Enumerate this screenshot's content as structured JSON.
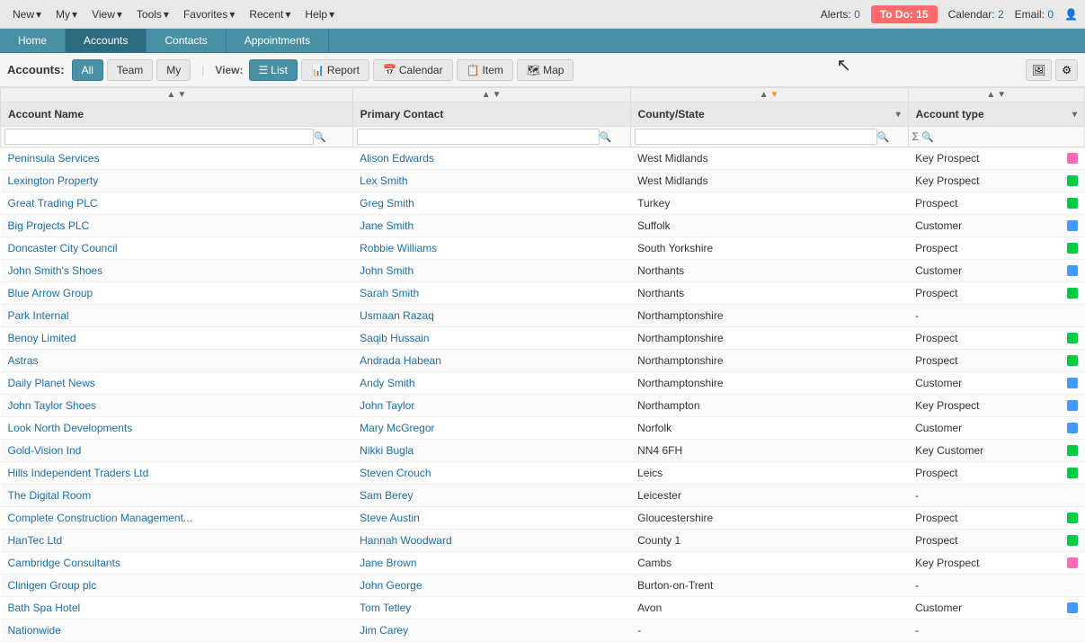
{
  "topnav": {
    "new_label": "New",
    "my_label": "My",
    "view_label": "View",
    "tools_label": "Tools",
    "favorites_label": "Favorites",
    "recent_label": "Recent",
    "help_label": "Help",
    "alerts_label": "Alerts:",
    "alerts_count": "0",
    "todo_label": "To Do:",
    "todo_count": "15",
    "calendar_label": "Calendar:",
    "calendar_count": "2",
    "email_label": "Email:",
    "email_count": "0"
  },
  "pagetabs": [
    {
      "label": "Home",
      "active": false
    },
    {
      "label": "Accounts",
      "active": true
    },
    {
      "label": "Contacts",
      "active": false
    },
    {
      "label": "Appointments",
      "active": false
    }
  ],
  "toolbar": {
    "accounts_label": "Accounts:",
    "all_label": "All",
    "team_label": "Team",
    "my_label": "My",
    "view_label": "View:",
    "list_label": "List",
    "report_label": "Report",
    "calendar_label": "Calendar",
    "item_label": "Item",
    "map_label": "Map"
  },
  "table": {
    "columns": [
      {
        "id": "account_name",
        "label": "Account Name",
        "has_dropdown": false
      },
      {
        "id": "primary_contact",
        "label": "Primary Contact",
        "has_dropdown": false
      },
      {
        "id": "county_state",
        "label": "County/State",
        "has_dropdown": true
      },
      {
        "id": "account_type",
        "label": "Account type",
        "has_dropdown": true
      }
    ],
    "rows": [
      {
        "account": "Peninsula Services",
        "contact": "Alison Edwards",
        "county": "West Midlands",
        "type": "Key Prospect",
        "color": "#ff69b4"
      },
      {
        "account": "Lexington Property",
        "contact": "Lex Smith",
        "county": "West Midlands",
        "type": "Key Prospect",
        "color": "#00cc44"
      },
      {
        "account": "Great Trading PLC",
        "contact": "Greg Smith",
        "county": "Turkey",
        "type": "Prospect",
        "color": "#00cc44"
      },
      {
        "account": "Big Projects PLC",
        "contact": "Jane Smith",
        "county": "Suffolk",
        "type": "Customer",
        "color": "#4499ff"
      },
      {
        "account": "Doncaster City Council",
        "contact": "Robbie Williams",
        "county": "South Yorkshire",
        "type": "Prospect",
        "color": "#00cc44"
      },
      {
        "account": "John Smith's Shoes",
        "contact": "John Smith",
        "county": "Northants",
        "type": "Customer",
        "color": "#4499ff"
      },
      {
        "account": "Blue Arrow Group",
        "contact": "Sarah Smith",
        "county": "Northants",
        "type": "Prospect",
        "color": "#00cc44"
      },
      {
        "account": "Park Internal",
        "contact": "Usmaan Razaq",
        "county": "Northamptonshire",
        "type": "-",
        "color": null
      },
      {
        "account": "Benoy Limited",
        "contact": "Saqib Hussain",
        "county": "Northamptonshire",
        "type": "Prospect",
        "color": "#00cc44"
      },
      {
        "account": "Astras",
        "contact": "Andrada Habean",
        "county": "Northamptonshire",
        "type": "Prospect",
        "color": "#00cc44"
      },
      {
        "account": "Daily Planet News",
        "contact": "Andy Smith",
        "county": "Northamptonshire",
        "type": "Customer",
        "color": "#4499ff"
      },
      {
        "account": "John Taylor Shoes",
        "contact": "John Taylor",
        "county": "Northampton",
        "type": "Key Prospect",
        "color": "#4499ff"
      },
      {
        "account": "Look North Developments",
        "contact": "Mary McGregor",
        "county": "Norfolk",
        "type": "Customer",
        "color": "#4499ff"
      },
      {
        "account": "Gold-Vision Ind",
        "contact": "Nikki Bugla",
        "county": "NN4 6FH",
        "type": "Key Customer",
        "color": "#00cc44"
      },
      {
        "account": "Hills Independent Traders Ltd",
        "contact": "Steven Crouch",
        "county": "Leics",
        "type": "Prospect",
        "color": "#00cc44"
      },
      {
        "account": "The Digital Room",
        "contact": "Sam Berey",
        "county": "Leicester",
        "type": "-",
        "color": null
      },
      {
        "account": "Complete Construction Management...",
        "contact": "Steve Austin",
        "county": "Gloucestershire",
        "type": "Prospect",
        "color": "#00cc44"
      },
      {
        "account": "HanTec Ltd",
        "contact": "Hannah Woodward",
        "county": "County 1",
        "type": "Prospect",
        "color": "#00cc44"
      },
      {
        "account": "Cambridge Consultants",
        "contact": "Jane Brown",
        "county": "Cambs",
        "type": "Key Prospect",
        "color": "#ff69b4"
      },
      {
        "account": "Clinigen Group plc",
        "contact": "John George",
        "county": "Burton-on-Trent",
        "type": "-",
        "color": null
      },
      {
        "account": "Bath Spa Hotel",
        "contact": "Tom Tetley",
        "county": "Avon",
        "type": "Customer",
        "color": "#4499ff"
      },
      {
        "account": "Nationwide",
        "contact": "Jim Carey",
        "county": "-",
        "type": "-",
        "color": null
      }
    ]
  }
}
